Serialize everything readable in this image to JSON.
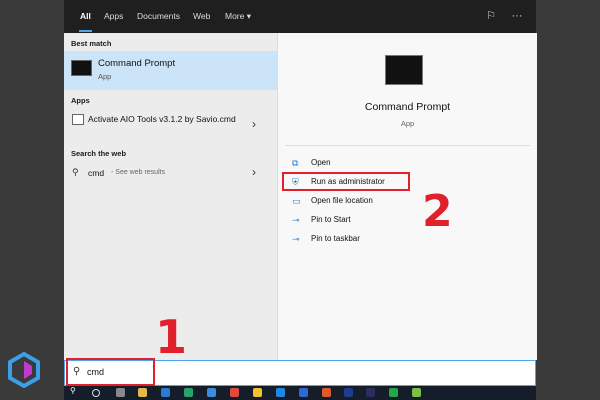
{
  "tabs": [
    {
      "label": "All"
    },
    {
      "label": "Apps"
    },
    {
      "label": "Documents"
    },
    {
      "label": "Web"
    },
    {
      "label": "More ▾"
    }
  ],
  "top_icons": [
    "feedback-icon",
    "more-options-icon"
  ],
  "left": {
    "best_match_header": "Best match",
    "best_match": {
      "title": "Command Prompt",
      "subtitle": "App"
    },
    "apps_header": "Apps",
    "app_item": {
      "title": "Activate AIO Tools v3.1.2 by Savio.cmd"
    },
    "web_header": "Search the web",
    "web_item": {
      "query": "cmd",
      "note": "- See web results"
    }
  },
  "right": {
    "title": "Command Prompt",
    "subtitle": "App",
    "actions": [
      {
        "label": "Open",
        "icon": "open-icon"
      },
      {
        "label": "Run as administrator",
        "icon": "admin-shield-icon"
      },
      {
        "label": "Open file location",
        "icon": "folder-location-icon"
      },
      {
        "label": "Pin to Start",
        "icon": "pin-icon"
      },
      {
        "label": "Pin to taskbar",
        "icon": "pin-icon"
      }
    ]
  },
  "search": {
    "value": "cmd"
  },
  "annotations": {
    "step1": "1",
    "step2": "2"
  },
  "colors": {
    "accent": "#4ea6ea",
    "highlight": "#cce4f7",
    "annotation": "#e0202a",
    "topbar": "#1f1f1f"
  }
}
